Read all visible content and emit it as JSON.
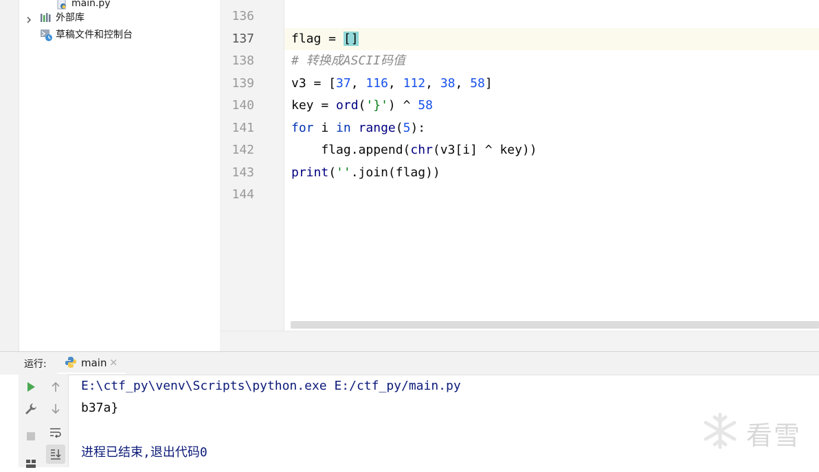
{
  "project_tree": {
    "items": [
      {
        "label": "main.py",
        "icon": "python-file-icon"
      },
      {
        "label": "外部库",
        "icon": "library-icon"
      },
      {
        "label": "草稿文件和控制台",
        "icon": "scratches-icon"
      }
    ]
  },
  "editor": {
    "line_numbers": [
      "136",
      "137",
      "138",
      "139",
      "140",
      "141",
      "142",
      "143",
      "144"
    ],
    "current_line": "137",
    "code": {
      "l137_a": "flag = ",
      "l137_b": "[]",
      "l138": "# 转换成ASCII码值",
      "l139_a": "v3 = [",
      "l139_n1": "37",
      "l139_s1": ", ",
      "l139_n2": "116",
      "l139_s2": ", ",
      "l139_n3": "112",
      "l139_s3": ", ",
      "l139_n4": "38",
      "l139_s4": ", ",
      "l139_n5": "58",
      "l139_e": "]",
      "l140_a": "key = ",
      "l140_fn": "ord",
      "l140_b": "(",
      "l140_str": "'}'",
      "l140_c": ") ^ ",
      "l140_num": "58",
      "l141_kw1": "for",
      "l141_a": " i ",
      "l141_kw2": "in",
      "l141_b": " ",
      "l141_fn": "range",
      "l141_c": "(",
      "l141_num": "5",
      "l141_d": "):",
      "l142_a": "    flag.append(",
      "l142_fn": "chr",
      "l142_b": "(v3[i] ^ key))",
      "l143_fn": "print",
      "l143_a": "(",
      "l143_str": "''",
      "l143_b": ".join(flag))"
    }
  },
  "run_panel": {
    "title": "运行:",
    "tab_label": "main",
    "tab_close": "×",
    "output": {
      "command": "E:\\ctf_py\\venv\\Scripts\\python.exe E:/ctf_py/main.py",
      "result": "b37a}",
      "exit_message": "进程已结束,退出代码0"
    },
    "colors": {
      "command": "#0b1a78",
      "result": "#080808",
      "exit": "#0b1a78",
      "run_green": "#4aa852"
    }
  },
  "watermark": {
    "text": "看雪"
  }
}
